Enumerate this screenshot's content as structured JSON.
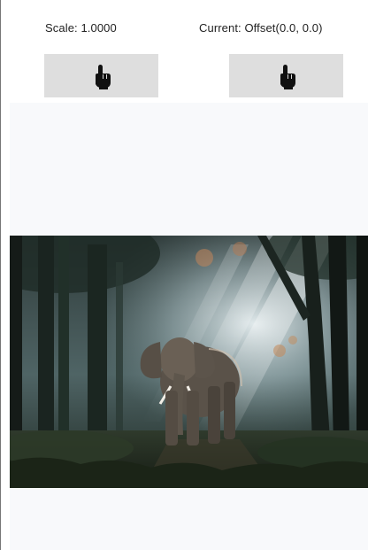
{
  "header": {
    "scale_text": "Scale: 1.0000",
    "offset_text": "Current: Offset(0.0, 0.0)"
  },
  "buttons": [
    {
      "icon": "pointer-hand-icon"
    },
    {
      "icon": "pointer-hand-icon"
    }
  ],
  "image": {
    "subject": "elephant-in-forest-photo"
  },
  "colors": {
    "button_bg": "#dedede",
    "canvas_bg": "#f8f9fb",
    "text": "#222222"
  }
}
